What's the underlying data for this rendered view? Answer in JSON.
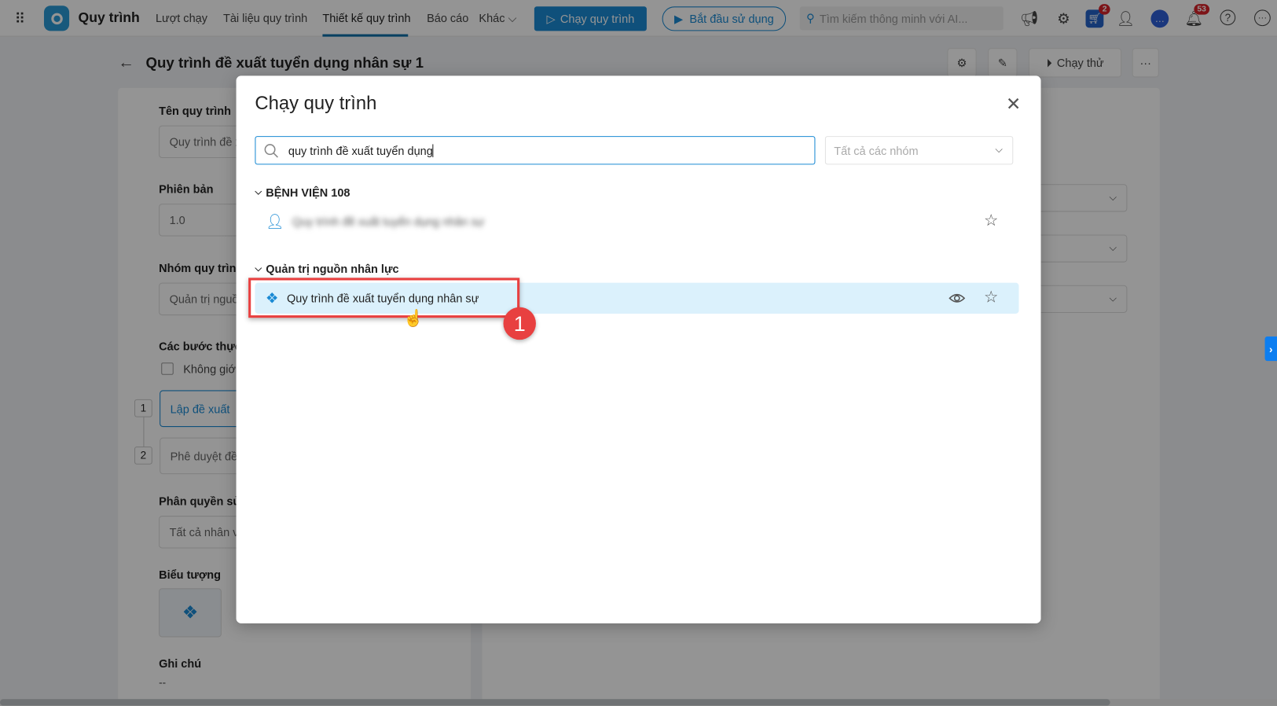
{
  "header": {
    "app_name": "Quy trình",
    "nav": [
      "Lượt chạy",
      "Tài liệu quy trình",
      "Thiết kế quy trình",
      "Báo cáo",
      "Khác"
    ],
    "run_button": "Chạy quy trình",
    "start_button": "Bắt đầu sử dụng",
    "search_placeholder": "Tìm kiếm thông minh với AI...",
    "cart_badge": "2",
    "notif_badge": "53"
  },
  "page": {
    "title": "Quy trình đề xuất tuyển dụng nhân sự 1",
    "test_run": "Chạy thử",
    "form": {
      "name_label": "Tên quy trình",
      "name_value": "Quy trình đề x",
      "version_label": "Phiên bản",
      "version_value": "1.0",
      "group_label": "Nhóm quy trình",
      "group_value": "Quản trị nguồn",
      "steps_label": "Các bước thực h",
      "unlimited_label": "Không giới",
      "steps": [
        {
          "num": "1",
          "label": "Lập đề xuất"
        },
        {
          "num": "2",
          "label": "Phê duyệt đề"
        }
      ],
      "perm_label": "Phân quyền sử d",
      "perm_value": "Tất cả nhân vi",
      "icon_label": "Biểu tượng",
      "note_label": "Ghi chú",
      "note_value": "--"
    }
  },
  "modal": {
    "title": "Chạy quy trình",
    "search_value": "quy trình đề xuất tuyển dụng",
    "group_select": "Tất cả các nhóm",
    "groups": [
      {
        "name": "BỆNH VIỆN 108",
        "items": [
          {
            "label": "Quy trình đề xuất tuyển dụng nhân sự"
          }
        ]
      },
      {
        "name": "Quản trị nguồn nhân lực",
        "items": [
          {
            "label": "Quy trình đề xuất tuyển dụng nhân sự"
          }
        ]
      }
    ]
  },
  "annotation": {
    "step": "1"
  },
  "colors": {
    "accent": "#1a8ad4",
    "highlight": "#e84040",
    "selected_row": "#dbf1fc"
  }
}
